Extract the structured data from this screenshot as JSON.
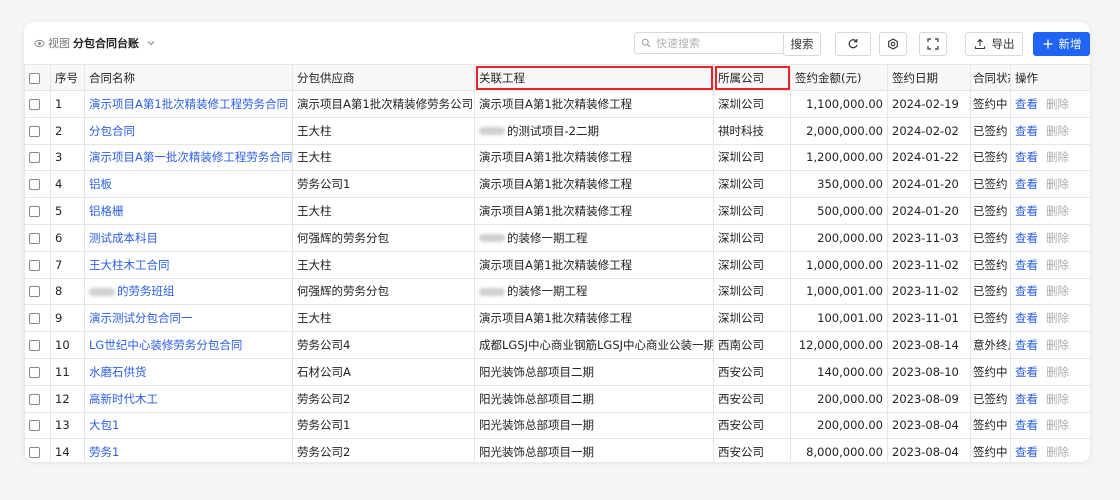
{
  "toolbar": {
    "view_label": "视图",
    "view_name": "分包合同台账",
    "search_placeholder": "快速搜索",
    "search_button": "搜索",
    "export_label": "导出",
    "new_label": "新增"
  },
  "table": {
    "headers": {
      "index": "序号",
      "name": "合同名称",
      "supplier": "分包供应商",
      "project": "关联工程",
      "company": "所属公司",
      "amount": "签约金额(元)",
      "date": "签约日期",
      "status": "合同状态",
      "ops": "操作"
    },
    "view_text": "查看",
    "delete_text": "删除",
    "rows": [
      {
        "index": "1",
        "name": "演示项目A第1批次精装修工程劳务合同",
        "supplier": "演示项目A第1批次精装修劳务公司",
        "project": "演示项目A第1批次精装修工程",
        "company": "深圳公司",
        "amount": "1,100,000.00",
        "date": "2024-02-19",
        "status": "签约中"
      },
      {
        "index": "2",
        "name": "分包合同",
        "supplier": "王大柱",
        "project": "的测试项目-2二期",
        "project_redacted": true,
        "company": "祺时科技",
        "amount": "2,000,000.00",
        "date": "2024-02-02",
        "status": "已签约"
      },
      {
        "index": "3",
        "name": "演示项目A第一批次精装修工程劳务合同",
        "supplier": "王大柱",
        "project": "演示项目A第1批次精装修工程",
        "company": "深圳公司",
        "amount": "1,200,000.00",
        "date": "2024-01-22",
        "status": "已签约"
      },
      {
        "index": "4",
        "name": "铝板",
        "supplier": "劳务公司1",
        "project": "演示项目A第1批次精装修工程",
        "company": "深圳公司",
        "amount": "350,000.00",
        "date": "2024-01-20",
        "status": "已签约"
      },
      {
        "index": "5",
        "name": "铝格栅",
        "supplier": "王大柱",
        "project": "演示项目A第1批次精装修工程",
        "company": "深圳公司",
        "amount": "500,000.00",
        "date": "2024-01-20",
        "status": "已签约"
      },
      {
        "index": "6",
        "name": "测试成本科目",
        "supplier": "何强辉的劳务分包",
        "project": "的装修一期工程",
        "project_redacted": true,
        "company": "深圳公司",
        "amount": "200,000.00",
        "date": "2023-11-03",
        "status": "已签约"
      },
      {
        "index": "7",
        "name": "王大柱木工合同",
        "supplier": "王大柱",
        "project": "演示项目A第1批次精装修工程",
        "company": "深圳公司",
        "amount": "1,000,000.00",
        "date": "2023-11-02",
        "status": "已签约"
      },
      {
        "index": "8",
        "name": "的劳务班组",
        "name_redacted": true,
        "supplier": "何强辉的劳务分包",
        "project": "的装修一期工程",
        "project_redacted": true,
        "company": "深圳公司",
        "amount": "1,000,001.00",
        "date": "2023-11-02",
        "status": "已签约"
      },
      {
        "index": "9",
        "name": "演示测试分包合同一",
        "supplier": "王大柱",
        "project": "演示项目A第1批次精装修工程",
        "company": "深圳公司",
        "amount": "100,001.00",
        "date": "2023-11-01",
        "status": "已签约"
      },
      {
        "index": "10",
        "name": "LG世纪中心装修劳务分包合同",
        "supplier": "劳务公司4",
        "project": "成都LGSJ中心商业钢筋LGSJ中心商业公装一期",
        "company": "西南公司",
        "amount": "12,000,000.00",
        "date": "2023-08-14",
        "status": "意外终止"
      },
      {
        "index": "11",
        "name": "水磨石供货",
        "supplier": "石材公司A",
        "project": "阳光装饰总部项目二期",
        "company": "西安公司",
        "amount": "140,000.00",
        "date": "2023-08-10",
        "status": "签约中"
      },
      {
        "index": "12",
        "name": "高新时代木工",
        "supplier": "劳务公司2",
        "project": "阳光装饰总部项目二期",
        "company": "西安公司",
        "amount": "200,000.00",
        "date": "2023-08-09",
        "status": "已签约"
      },
      {
        "index": "13",
        "name": "大包1",
        "supplier": "劳务公司1",
        "project": "阳光装饰总部项目一期",
        "company": "西安公司",
        "amount": "200,000.00",
        "date": "2023-08-04",
        "status": "签约中"
      },
      {
        "index": "14",
        "name": "劳务1",
        "supplier": "劳务公司2",
        "project": "阳光装饰总部项目一期",
        "company": "西安公司",
        "amount": "8,000,000.00",
        "date": "2023-08-04",
        "status": "签约中"
      }
    ]
  },
  "colors": {
    "accent": "#1f64f5",
    "link": "#2a5ee8",
    "highlight": "#e22222"
  }
}
